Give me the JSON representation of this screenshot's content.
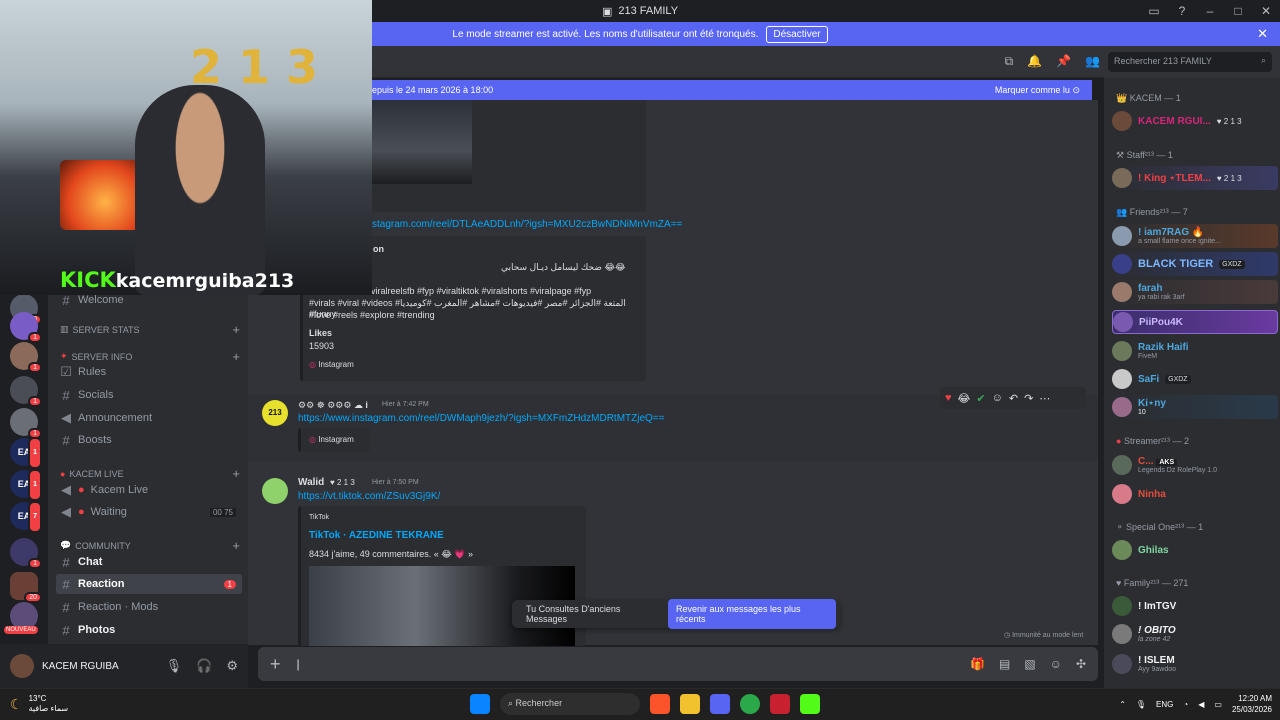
{
  "window": {
    "title": "213 FAMILY"
  },
  "banner": {
    "text": "Le mode streamer est activé. Les noms d'utilisateur ont été tronqués.",
    "button": "Désactiver"
  },
  "search": {
    "placeholder": "Rechercher 213 FAMILY"
  },
  "newbar": {
    "left": "epuis le 24 mars 2026 à 18:00",
    "right": "Marquer comme lu"
  },
  "stream": {
    "kick": "KICK",
    "channel": "kacemrguiba213"
  },
  "servers": [
    {
      "badge": "10"
    },
    {
      "badge": "1"
    },
    {
      "badge": "1"
    },
    {
      "badge": "1"
    },
    {
      "badge": "1"
    },
    {
      "badge": "1"
    },
    {
      "badge": "1"
    },
    {
      "badge": "7"
    },
    {
      "badge": "1"
    },
    {
      "badge": "20"
    },
    {
      "badge": "NOUVEAU"
    }
  ],
  "channels": {
    "welcome": "Welcome",
    "cat_server_stats": "SERVER STATS",
    "cat_server_info": "SERVER INFO",
    "rules": "Rules",
    "socials": "Socials",
    "announcement": "Announcement",
    "boosts": "Boosts",
    "cat_kacem_live": "KACEM LIVE",
    "kacem_live": "Kacem Live",
    "waiting": "Waiting",
    "waiting_count_a": "00",
    "waiting_count_b": "75",
    "cat_community": "COMMUNITY",
    "chat": "Chat",
    "reaction": "Reaction",
    "reaction_badge": "1",
    "reaction_mods": "Reaction · Mods",
    "photos": "Photos"
  },
  "user": {
    "name": "KACEM RGUIBA"
  },
  "messages": {
    "link1": "stagram.com/reel/DTLAeADDLnh/?igsh=MXU2czBwNDNiMnVmZA==",
    "embed1_author": "on",
    "embed1_arabic": "ضحك ليسامل ديـال سحابي 😂😂",
    "embed1_tags1": "viralreelsfb #fyp #viraltiktok #viralshorts #viralpage #fyp",
    "embed1_tags2": "#virals #viral #videos #المتعة #الجزائر #مصر #فيديوهات #مشاهر #المغرب #كوميديا #funny",
    "embed1_tags3": "#love #reels #explore #trending",
    "embed1_likes_label": "Likes",
    "embed1_likes": "15903",
    "embed1_provider": "Instagram",
    "msg2_time": "Hier à 7:42 PM",
    "msg2_link": "https://www.instagram.com/reel/DWMaph9jezh/?igsh=MXFmZHdzMDRtMTZjeQ==",
    "msg2_provider": "Instagram",
    "msg3_author": "Walid",
    "msg3_tag": "2 1 3",
    "msg3_time": "Hier à 7:50 PM",
    "msg3_link": "https://vt.tiktok.com/ZSuv3Gj9K/",
    "msg3_provider": "TikTok",
    "msg3_title": "TikTok · AZEDINE TEKRANE",
    "msg3_desc": "8434 j'aime, 49 commentaires. « 😂 💗 »"
  },
  "toast": {
    "text": "Tu Consultes D'anciens Messages",
    "button": "Revenir aux messages les plus récents"
  },
  "immunity": "Immunité au mode lent",
  "members": {
    "cat_kacem": "KACEM — 1",
    "kacem": "KACEM RGUI...",
    "kacem_tag": "2 1 3",
    "cat_staff": "Staff²¹³ — 1",
    "king": "! King ⋆TLEM...",
    "king_tag": "2 1 3",
    "cat_friends": "Friends²¹³ — 7",
    "iam7rag": "! iam7RAG 🔥",
    "iam7rag_sub": "a small flame once ignite...",
    "blacktiger": "BLACK TIGER",
    "blacktiger_tag": "GXDZ",
    "farah": "farah",
    "farah_sub": "ya rabi rak 3arf",
    "piipou": "PiiPou4K",
    "razik": "Razik Haifi",
    "razik_sub": "FiveM",
    "safi": "SaFi",
    "safi_tag": "GXDZ",
    "kimy": "Ki⋆ny",
    "kimy_sub": "10",
    "cat_streamer": "Streamer²¹³ — 2",
    "c": "C...",
    "c_tag": "AKS",
    "c_sub": "Legends Dz RolePlay 1.0",
    "ninha": "Ninha",
    "cat_special": "Special One²¹³ — 1",
    "ghilas": "Ghilas",
    "cat_family": "Family²¹³ — 271",
    "imtgv": "! ImTGV",
    "obito": "! OBITO",
    "obito_sub": "la zone 42",
    "islem": "! ISLEM",
    "islem_sub": "Ayy 9awdoo"
  },
  "taskbar": {
    "temp": "13°C",
    "weather": "سماء صافية",
    "search": "Rechercher",
    "lang": "ENG",
    "time": "12:20 AM",
    "date": "25/03/2026"
  }
}
